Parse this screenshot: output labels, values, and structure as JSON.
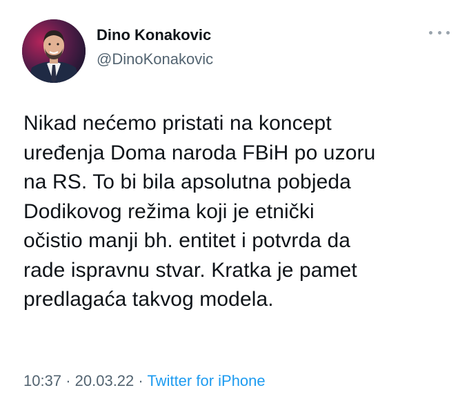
{
  "author": {
    "display_name": "Dino Konakovic",
    "handle": "@DinoKonakovic",
    "avatar_icon": "profile-photo"
  },
  "menu_icon": "more-horizontal-icon",
  "tweet": {
    "lines": [
      "Nikad nećemo pristati na koncept",
      "uređenja Doma naroda FBiH po uzoru",
      "na RS. To bi bila apsolutna pobjeda",
      "Dodikovog režima koji je etnički",
      "očistio manji bh. entitet i potvrda da",
      "rade ispravnu stvar. Kratka je pamet",
      "predlagaća takvog modela."
    ]
  },
  "meta": {
    "time": "10:37",
    "separator": "·",
    "date": "20.03.22",
    "source": "Twitter for iPhone"
  },
  "colors": {
    "text": "#0f1419",
    "secondary": "#536471",
    "link": "#1d9bf0"
  }
}
